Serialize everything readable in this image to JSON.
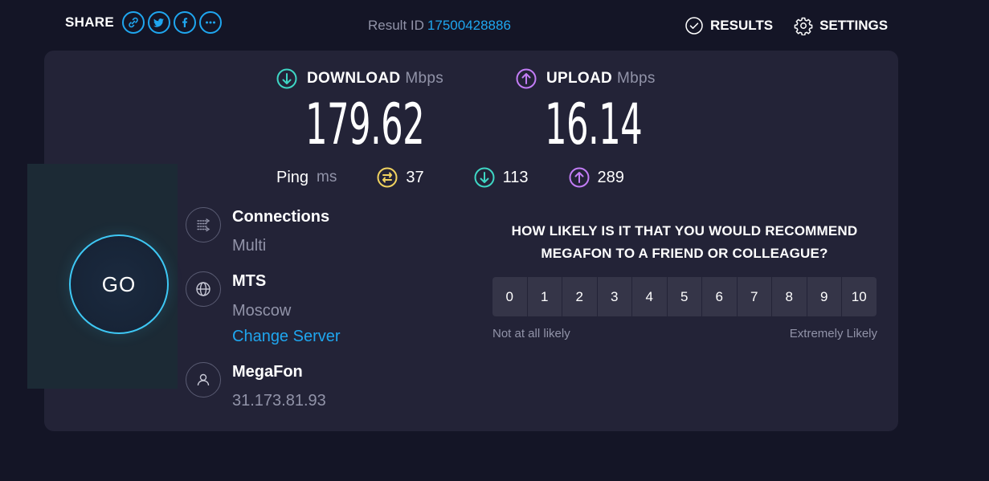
{
  "header": {
    "share_label": "SHARE",
    "share_icons": [
      "link-icon",
      "twitter-icon",
      "facebook-icon",
      "more-icon"
    ],
    "result_id_label": "Result ID",
    "result_id": "17500428886",
    "results_label": "RESULTS",
    "settings_label": "SETTINGS"
  },
  "speeds": {
    "download": {
      "label": "DOWNLOAD",
      "unit": "Mbps",
      "value": "179.62",
      "color": "#3ed6c4"
    },
    "upload": {
      "label": "UPLOAD",
      "unit": "Mbps",
      "value": "16.14",
      "color": "#c27cf5"
    }
  },
  "ping": {
    "label": "Ping",
    "unit": "ms",
    "idle": "37",
    "download": "113",
    "upload": "289",
    "idle_color": "#f1d35f"
  },
  "go": {
    "label": "GO",
    "accent": "#3ec8f5"
  },
  "connections": {
    "title": "Connections",
    "value": "Multi"
  },
  "server": {
    "name": "MTS",
    "location": "Moscow",
    "change_label": "Change Server"
  },
  "provider": {
    "name": "MegaFon",
    "ip": "31.173.81.93"
  },
  "survey": {
    "question": "HOW LIKELY IS IT THAT YOU WOULD RECOMMEND MEGAFON TO A FRIEND OR COLLEAGUE?",
    "options": [
      "0",
      "1",
      "2",
      "3",
      "4",
      "5",
      "6",
      "7",
      "8",
      "9",
      "10"
    ],
    "low_label": "Not at all likely",
    "high_label": "Extremely Likely"
  },
  "colors": {
    "background": "#141526",
    "panel": "#232337",
    "link": "#1fa6ef",
    "muted": "#9193a8"
  }
}
